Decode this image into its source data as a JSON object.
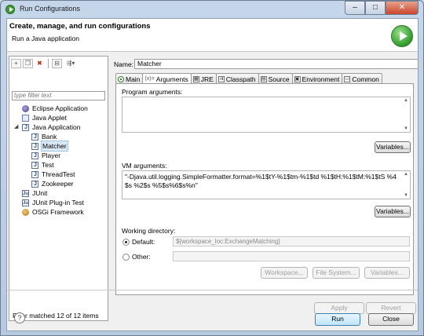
{
  "window": {
    "title": "Run Configurations",
    "min_glyph": "–",
    "max_glyph": "□",
    "close_glyph": "✕"
  },
  "header": {
    "title": "Create, manage, and run configurations",
    "subtitle": "Run a Java application"
  },
  "left": {
    "toolbar": {
      "new_glyph": "+",
      "duplicate_glyph": "❐",
      "delete_glyph": "✖",
      "collapse_glyph": "⊟",
      "filter_glyph": "⇶▾"
    },
    "filter_placeholder": "type filter text",
    "tree": [
      {
        "label": "Eclipse Application",
        "icon": "eclipse-icon",
        "level": 1
      },
      {
        "label": "Java Applet",
        "icon": "applet-icon",
        "level": 1
      },
      {
        "label": "Java Application",
        "icon": "java-app-icon",
        "level": 1,
        "expanded": true
      },
      {
        "label": "Bank",
        "icon": "java-app-icon",
        "level": 2
      },
      {
        "label": "Matcher",
        "icon": "java-app-icon",
        "level": 2,
        "selected": true
      },
      {
        "label": "Player",
        "icon": "java-app-icon",
        "level": 2
      },
      {
        "label": "Test",
        "icon": "java-app-icon",
        "level": 2
      },
      {
        "label": "ThreadTest",
        "icon": "java-app-icon",
        "level": 2
      },
      {
        "label": "Zookeeper",
        "icon": "java-app-icon",
        "level": 2
      },
      {
        "label": "JUnit",
        "icon": "junit-icon",
        "level": 1
      },
      {
        "label": "JUnit Plug-in Test",
        "icon": "junit-icon",
        "level": 1
      },
      {
        "label": "OSGi Framework",
        "icon": "osgi-icon",
        "level": 1
      }
    ],
    "expander_glyph": "◢",
    "status": "Filter matched 12 of 12 items"
  },
  "right": {
    "name_label": "Name:",
    "name_value": "Matcher",
    "tabs": [
      {
        "label": "Main",
        "glyph": "◉"
      },
      {
        "label": "Arguments",
        "glyph": "(x)=",
        "active": true
      },
      {
        "label": "JRE",
        "glyph": "▦"
      },
      {
        "label": "Classpath",
        "glyph": "⇉"
      },
      {
        "label": "Source",
        "glyph": "▤"
      },
      {
        "label": "Environment",
        "glyph": "▣"
      },
      {
        "label": "Common",
        "glyph": "▭"
      }
    ],
    "program_args_label": "Program arguments:",
    "program_args_value": "",
    "variables_label": "Variables...",
    "vm_args_label": "VM arguments:",
    "vm_args_value": "\"-Djava.util.logging.SimpleFormatter.format=%1$tY-%1$tm-%1$td %1$tH:%1$tM:%1$tS %4$s %2$s %5$s%6$s%n\"",
    "working_dir_label": "Working directory:",
    "default_label": "Default:",
    "default_value": "${workspace_loc:ExchangeMatching}",
    "other_label": "Other:",
    "other_value": "",
    "workspace_label": "Workspace...",
    "filesystem_label": "File System...",
    "scroll_up": "▲",
    "scroll_down": "▼"
  },
  "actions": {
    "apply": "Apply",
    "revert": "Revert",
    "run": "Run",
    "close": "Close",
    "help": "?"
  },
  "colors": {
    "run_green": "#2f9a2b",
    "delete_red": "#cc2211",
    "selection": "#dbe8f8"
  }
}
